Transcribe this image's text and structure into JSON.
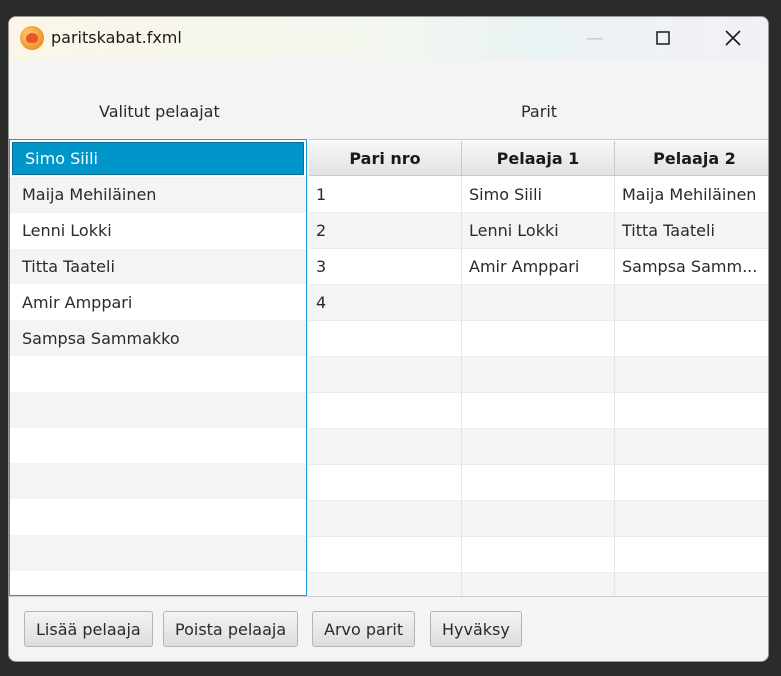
{
  "window": {
    "title": "paritskabat.fxml",
    "min_icon": "minimize-icon",
    "max_icon": "maximize-icon",
    "close_icon": "close-icon",
    "app_icon": "app-icon"
  },
  "labels": {
    "selected_players": "Valitut pelaajat",
    "pairs": "Parit"
  },
  "players": [
    "Simo Siili",
    "Maija Mehiläinen",
    "Lenni Lokki",
    "Titta Taateli",
    "Amir Amppari",
    "Sampsa Sammakko"
  ],
  "table": {
    "columns": [
      "Pari nro",
      "Pelaaja 1",
      "Pelaaja 2"
    ],
    "rows": [
      [
        "1",
        "Simo Siili",
        "Maija Mehiläinen"
      ],
      [
        "2",
        "Lenni Lokki",
        "Titta Taateli"
      ],
      [
        "3",
        "Amir Amppari",
        "Sampsa Samm..."
      ],
      [
        "4",
        "",
        ""
      ]
    ]
  },
  "buttons": {
    "add": "Lisää pelaaja",
    "remove": "Poista pelaaja",
    "draw": "Arvo parit",
    "accept": "Hyväksy"
  },
  "colors": {
    "selection": "#0096c9",
    "focus_border": "#1e9ad6"
  }
}
